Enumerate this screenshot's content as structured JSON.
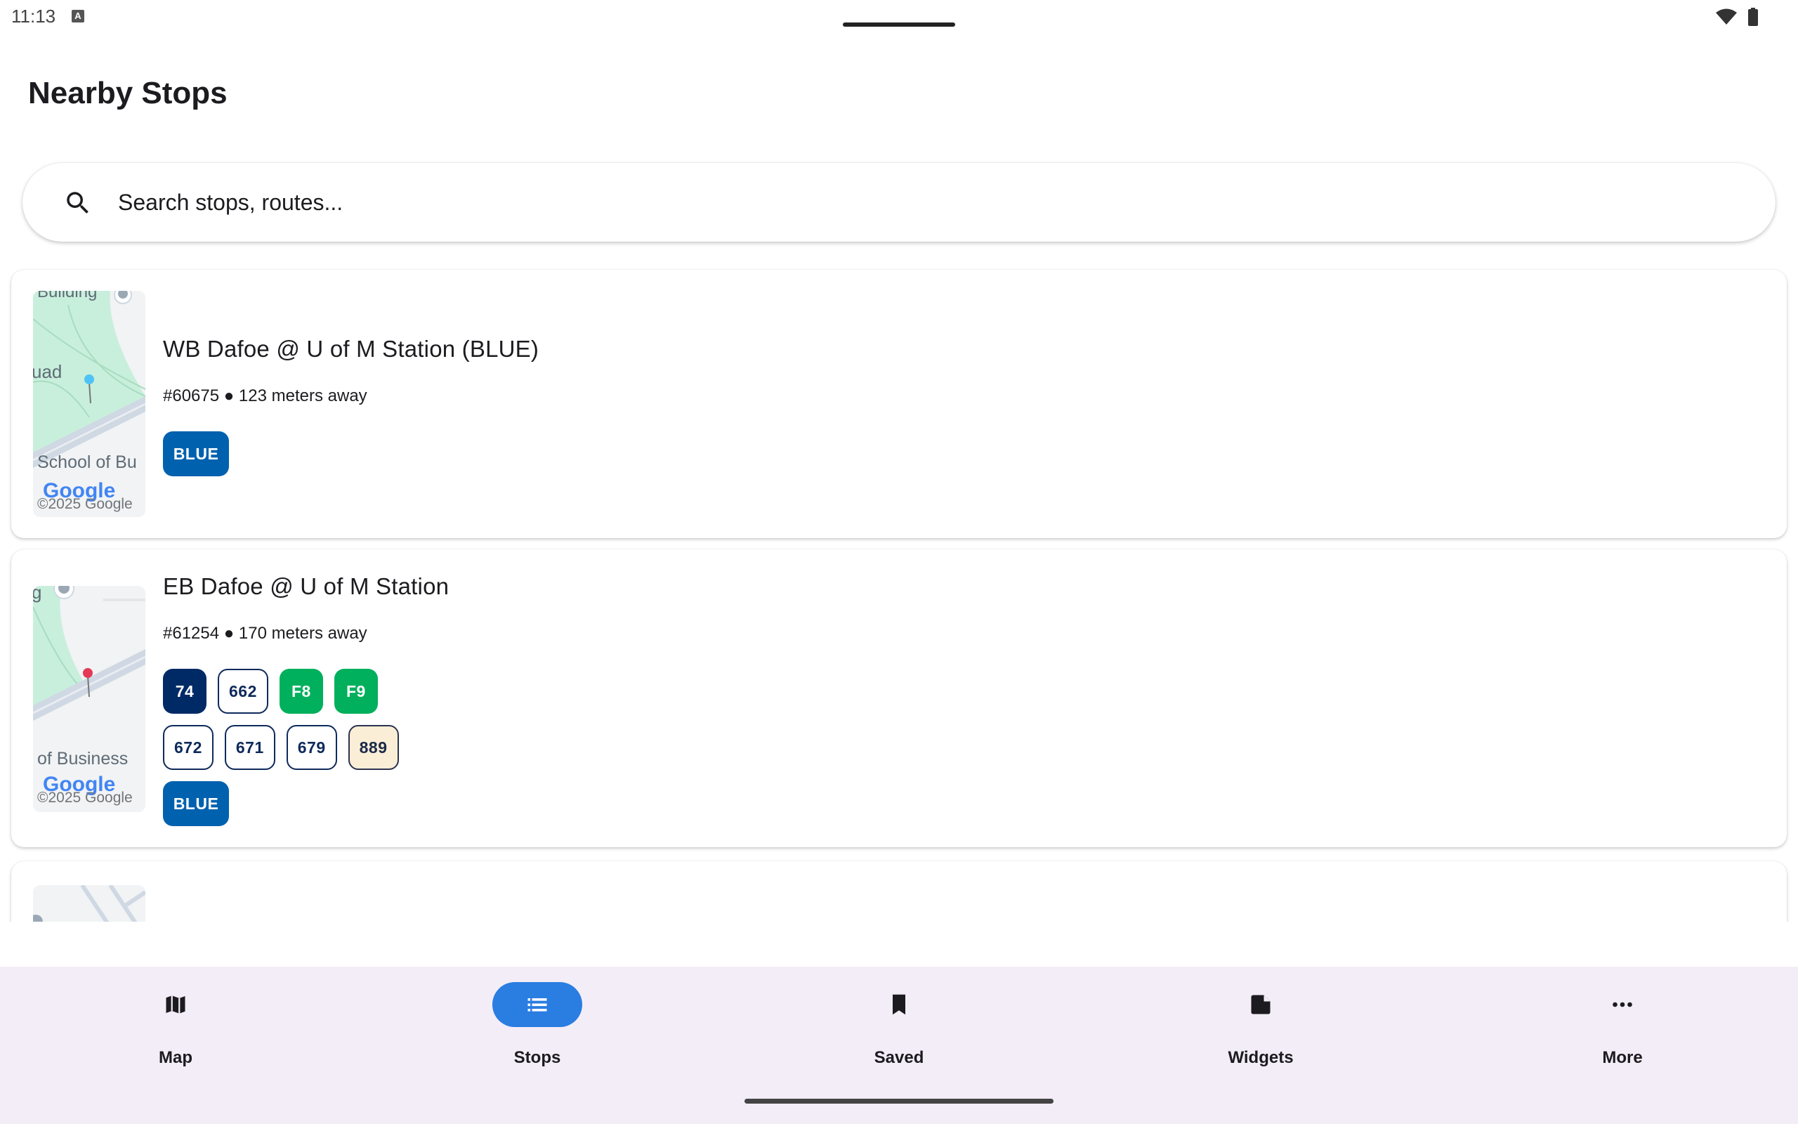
{
  "status_bar": {
    "time": "11:13",
    "input_indicator": "A"
  },
  "page": {
    "title": "Nearby Stops"
  },
  "search": {
    "placeholder": "Search stops, routes..."
  },
  "stops": [
    {
      "name": "WB Dafoe @ U of M Station (BLUE)",
      "meta": "#60675 ● 123 meters away",
      "map": {
        "label_top": "Building",
        "label_left": "uad",
        "label_bottom": "School of Bu",
        "logo": "Google",
        "copyright": "©2025 Google",
        "pin_color": "#4fc3f7"
      },
      "route_rows": [
        [
          {
            "label": "BLUE",
            "style": "blue"
          }
        ]
      ]
    },
    {
      "name": "EB Dafoe @ U of M Station",
      "meta": "#61254 ● 170 meters away",
      "map": {
        "label_left": "g",
        "label_bottom": "of Business",
        "logo": "Google",
        "copyright": "©2025 Google",
        "pin_color": "#e53958"
      },
      "route_rows": [
        [
          {
            "label": "74",
            "style": "navy"
          },
          {
            "label": "662",
            "style": "outline"
          },
          {
            "label": "F8",
            "style": "green"
          },
          {
            "label": "F9",
            "style": "green"
          }
        ],
        [
          {
            "label": "672",
            "style": "outline"
          },
          {
            "label": "671",
            "style": "outline"
          },
          {
            "label": "679",
            "style": "outline"
          },
          {
            "label": "889",
            "style": "cream"
          }
        ],
        [
          {
            "label": "BLUE",
            "style": "blue"
          }
        ]
      ]
    }
  ],
  "nav": {
    "items": [
      {
        "label": "Map",
        "icon": "map-icon",
        "active": false
      },
      {
        "label": "Stops",
        "icon": "list-icon",
        "active": true
      },
      {
        "label": "Saved",
        "icon": "bookmark-icon",
        "active": false
      },
      {
        "label": "Widgets",
        "icon": "widgets-icon",
        "active": false
      },
      {
        "label": "More",
        "icon": "more-horiz-icon",
        "active": false
      }
    ]
  },
  "colors": {
    "accent": "#2a7de1",
    "nav_bg": "#f3edf7",
    "route_blue": "#0061af",
    "route_navy": "#002a66",
    "route_green": "#00b05c",
    "route_cream": "#fbeed6",
    "map_green": "#c8efdc",
    "map_road": "#cfd8e3"
  }
}
